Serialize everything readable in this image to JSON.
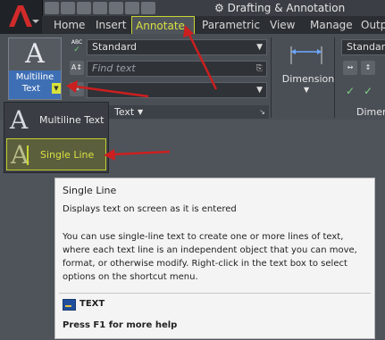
{
  "window": {
    "workspace_label": "Drafting & Annotation"
  },
  "tabs": [
    {
      "label": "Home"
    },
    {
      "label": "Insert"
    },
    {
      "label": "Annotate"
    },
    {
      "label": "Parametric"
    },
    {
      "label": "View"
    },
    {
      "label": "Manage"
    },
    {
      "label": "Outp"
    }
  ],
  "ribbon": {
    "multiline_button": {
      "big_letter": "A",
      "label_line1": "Multiline",
      "label_line2": "Text"
    },
    "text_style_value": "Standard",
    "find_text_placeholder": "Find text",
    "text_panel_label": "Text",
    "abc_label": "ABC",
    "dimension_label": "Dimension",
    "dim_style_value": "Standard",
    "dimensions_panel_label": "Dimer"
  },
  "dropdown": {
    "items": [
      {
        "label": "Multiline Text",
        "icon_letter": "A"
      },
      {
        "label": "Single Line",
        "icon_letter": "A"
      }
    ]
  },
  "tooltip": {
    "title": "Single Line",
    "subtitle": "Displays text on screen as it is entered",
    "body_lines": [
      "You can use single-line text to create one or more lines of text,",
      "where each text line is an independent object that you can move,",
      "format, or otherwise modify. Right-click in the text box to select",
      "options on the shortcut menu."
    ],
    "command": "TEXT",
    "help": "Press F1 for more help"
  },
  "colors": {
    "accent": "#c9d630",
    "arrow": "#cc1f1f",
    "ribbon_blue": "#3e6fb5"
  }
}
